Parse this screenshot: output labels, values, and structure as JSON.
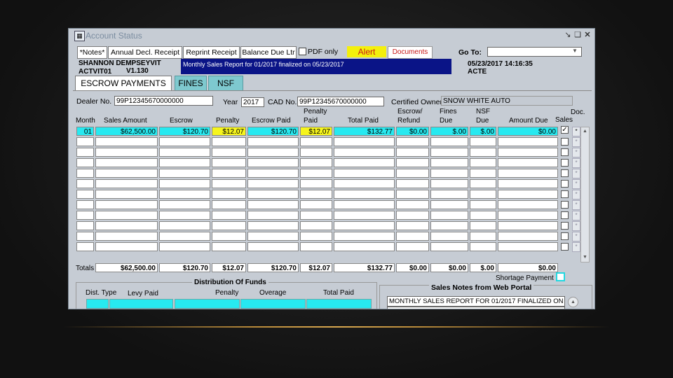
{
  "window": {
    "title": "Account Status"
  },
  "toolbar": {
    "notes": "*Notes*",
    "annual_receipt": "Annual Decl. Receipt",
    "reprint_receipt": "Reprint Receipt",
    "balance_due": "Balance Due Ltr",
    "pdf_only": "PDF only",
    "alert": "Alert",
    "documents": "Documents",
    "goto_label": "Go To:",
    "goto_value": ""
  },
  "account": {
    "user": "SHANNON DEMPSEYVIT",
    "code": "ACTVIT01",
    "version": "V1.130",
    "message": "Monthly Sales Report for 01/2017 finalized on 05/23/2017",
    "datetime": "05/23/2017 14:16:35",
    "status": "ACTE"
  },
  "tabs": [
    {
      "label": "ESCROW PAYMENTS"
    },
    {
      "label": "FINES"
    },
    {
      "label": "NSF"
    }
  ],
  "form": {
    "dealer_label": "Dealer No.",
    "dealer_value": "99P12345670000000",
    "year_label": "Year",
    "year_value": "2017",
    "cad_label": "CAD No.",
    "cad_value": "99P12345670000000",
    "owner_label": "Certified Owner",
    "owner_value": "SNOW WHITE AUTO"
  },
  "table": {
    "headers": {
      "month": "Month",
      "sales_amount": "Sales Amount",
      "escrow": "Escrow",
      "penalty": "Penalty",
      "escrow_paid": "Escrow Paid",
      "penalty_paid": "Penalty Paid",
      "total_paid": "Total Paid",
      "escrow_refund": "Escrow/ Refund",
      "fines_due": "Fines Due",
      "nsf_due": "NSF Due",
      "amount_due": "Amount Due",
      "sales": "Sales",
      "doc": "Doc."
    },
    "row1": {
      "month": "01",
      "sales_amount": "$62,500.00",
      "escrow": "$120.70",
      "penalty": "$12.07",
      "escrow_paid": "$120.70",
      "penalty_paid": "$12.07",
      "total_paid": "$132.77",
      "escrow_refund": "$0.00",
      "fines_due": "$.00",
      "nsf_due": "$.00",
      "amount_due": "$0.00",
      "sales_checked": true
    },
    "totals": {
      "label": "Totals",
      "sales_amount": "$62,500.00",
      "escrow": "$120.70",
      "penalty": "$12.07",
      "escrow_paid": "$120.70",
      "penalty_paid": "$12.07",
      "total_paid": "$132.77",
      "escrow_refund": "$0.00",
      "fines_due": "$0.00",
      "nsf_due": "$.00",
      "amount_due": "$0.00"
    }
  },
  "shortage": {
    "label": "Shortage Payment"
  },
  "distribution": {
    "title": "Distribution Of Funds",
    "dist_type": "Dist. Type",
    "levy_paid": "Levy Paid",
    "penalty": "Penalty",
    "overage": "Overage",
    "total_paid": "Total Paid"
  },
  "sales_notes": {
    "title": "Sales Notes from Web Portal",
    "note": "MONTHLY SALES REPORT FOR 01/2017 FINALIZED ON"
  },
  "colors": {
    "cyan": "#27e9f0",
    "yellow": "#f6f51c",
    "navy": "#0a1487",
    "tab_inactive": "#7ec9cf"
  }
}
